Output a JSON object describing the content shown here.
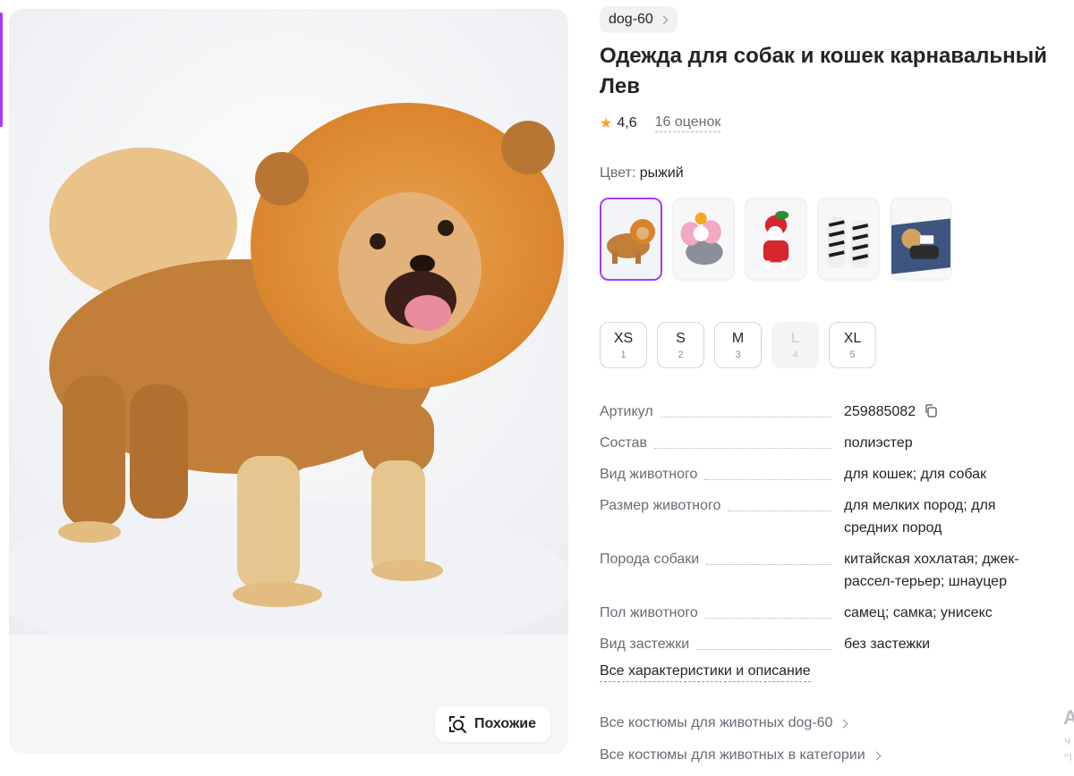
{
  "product": {
    "brand_label": "dog-60",
    "title": "Одежда для собак и кошек карнавальный Лев",
    "rating": "4,6",
    "reviews": "16 оценок",
    "color_label": "Цвет:",
    "color_value": "рыжий"
  },
  "colors": {
    "accent": "#a73afd",
    "star": "#ff9e2c",
    "text": "#242424",
    "muted": "#6b6b78"
  },
  "gallery": {
    "similar_label": "Похожие"
  },
  "sizes": [
    {
      "label": "XS",
      "num": "1",
      "available": true
    },
    {
      "label": "S",
      "num": "2",
      "available": true
    },
    {
      "label": "M",
      "num": "3",
      "available": true
    },
    {
      "label": "L",
      "num": "4",
      "available": false
    },
    {
      "label": "XL",
      "num": "5",
      "available": true
    }
  ],
  "specs": [
    {
      "key": "Артикул",
      "value": "259885082"
    },
    {
      "key": "Состав",
      "value": "полиэстер"
    },
    {
      "key": "Вид животного",
      "value": "для кошек; для собак"
    },
    {
      "key": "Размер животного",
      "value": "для мелких пород; для средних пород"
    },
    {
      "key": "Порода собаки",
      "value": "китайская хохлатая; джек-рассел-терьер; шнауцер"
    },
    {
      "key": "Пол животного",
      "value": "самец; самка; унисекс"
    },
    {
      "key": "Вид застежки",
      "value": "без застежки"
    }
  ],
  "links": {
    "all_specs": "Все характеристики и описание",
    "brand_costumes": "Все костюмы для животных dog-60",
    "category_costumes": "Все костюмы для животных в категории"
  },
  "edge": {
    "glyph": "А",
    "line1": "ч",
    "line2": "\"!"
  }
}
